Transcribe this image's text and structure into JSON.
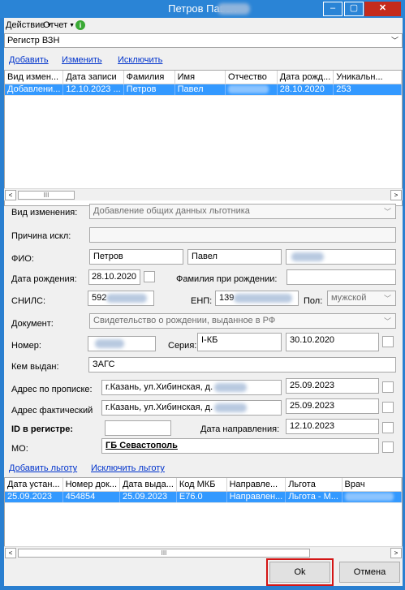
{
  "window": {
    "title": "Петров Павел",
    "min": "–",
    "max": "▢",
    "close": "✕"
  },
  "menu": {
    "action": "Действие",
    "report": "Отчет",
    "info": "i"
  },
  "registry": {
    "selected": "Регистр ВЗН"
  },
  "top_links": {
    "add": "Добавить",
    "edit": "Изменить",
    "exclude": "Исключить"
  },
  "changes_grid": {
    "columns": [
      "Вид измен...",
      "Дата записи",
      "Фамилия",
      "Имя",
      "Отчество",
      "Дата рожд...",
      "Уникальн..."
    ],
    "rows": [
      [
        "Добавлени...",
        "12.10.2023 ...",
        "Петров",
        "Павел",
        "",
        "28.10.2020",
        "253"
      ]
    ]
  },
  "form": {
    "change_type_label": "Вид изменения:",
    "change_type_value": "Добавление общих данных льготника",
    "exclusion_reason_label": "Причина искл:",
    "fio_label": "ФИО:",
    "last_name": "Петров",
    "first_name": "Павел",
    "birth_date_label": "Дата рождения:",
    "birth_date": "28.10.2020",
    "birth_surname_label": "Фамилия при рождении:",
    "snils_label": "СНИЛС:",
    "snils_value": "592",
    "enp_label": "ЕНП:",
    "enp_value": "139",
    "gender_label": "Пол:",
    "gender_value": "мужской",
    "document_label": "Документ:",
    "document_value": "Свидетельство о рождении, выданное в РФ",
    "number_label": "Номер:",
    "series_label": "Серия:",
    "series_value": "I-КБ",
    "doc_date": "30.10.2020",
    "issued_by_label": "Кем выдан:",
    "issued_by_value": "ЗАГС",
    "reg_address_label": "Адрес по прописке:",
    "reg_address_value": "г.Казань, ул.Хибинская, д.",
    "reg_address_date": "25.09.2023",
    "fact_address_label": "Адрес фактический",
    "fact_address_value": "г.Казань, ул.Хибинская, д.",
    "fact_address_date": "25.09.2023",
    "registry_id_label": "ID в регистре:",
    "direction_date_label": "Дата направления:",
    "direction_date": "12.10.2023",
    "mo_label": "МО:",
    "mo_value": "ГБ Севастополь"
  },
  "benefit_links": {
    "add": "Добавить льготу",
    "exclude": "Исключить льготу"
  },
  "benefits_grid": {
    "columns": [
      "Дата устан...",
      "Номер док...",
      "Дата выда...",
      "Код МКБ",
      "Направле...",
      "Льгота",
      "Врач"
    ],
    "rows": [
      [
        "25.09.2023",
        "454854",
        "25.09.2023",
        "E76.0",
        "Направлен...",
        "Льгота - М...",
        ""
      ]
    ]
  },
  "scroll": {
    "thumb": "III",
    "left": "<",
    "right": ">"
  },
  "buttons": {
    "ok": "Ok",
    "cancel": "Отмена"
  },
  "colors": {
    "titlebar": "#2a84d6",
    "selection": "#3399ff",
    "link": "#0033cc",
    "highlight_outline": "#d31515"
  }
}
